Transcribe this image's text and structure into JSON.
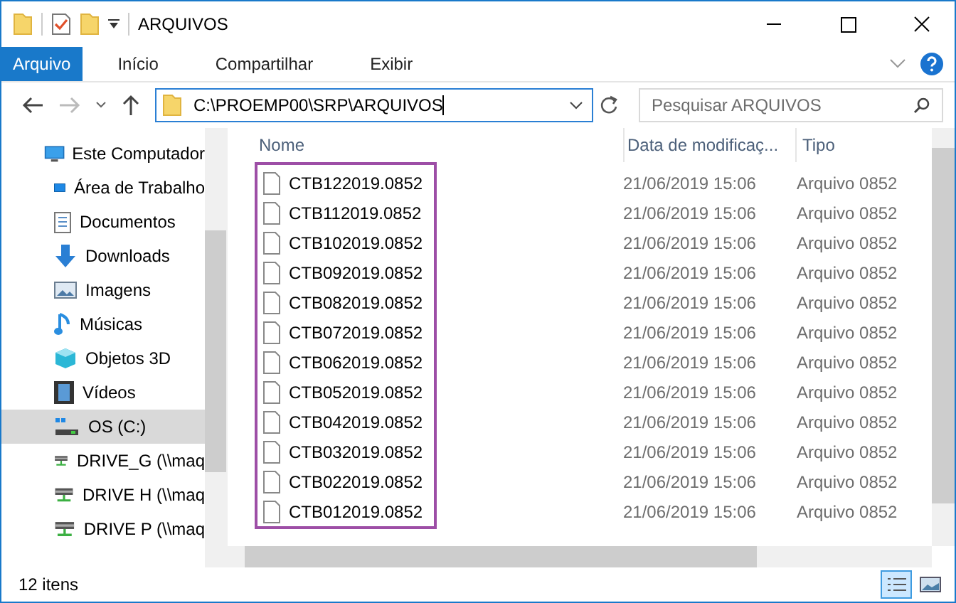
{
  "window": {
    "title": "ARQUIVOS"
  },
  "ribbon_tabs": [
    {
      "label": "Arquivo",
      "selected": true
    },
    {
      "label": "Início",
      "selected": false
    },
    {
      "label": "Compartilhar",
      "selected": false
    },
    {
      "label": "Exibir",
      "selected": false
    }
  ],
  "address": {
    "path": "C:\\PROEMP00\\SRP\\ARQUIVOS"
  },
  "search": {
    "placeholder": "Pesquisar ARQUIVOS"
  },
  "sidebar": {
    "items": [
      {
        "label": "Este Computador",
        "kind": "computer",
        "selected": false,
        "children": [
          {
            "label": "Área de Trabalho",
            "kind": "desktop",
            "selected": false
          },
          {
            "label": "Documentos",
            "kind": "documents",
            "selected": false
          },
          {
            "label": "Downloads",
            "kind": "downloads",
            "selected": false
          },
          {
            "label": "Imagens",
            "kind": "pictures",
            "selected": false
          },
          {
            "label": "Músicas",
            "kind": "music",
            "selected": false
          },
          {
            "label": "Objetos 3D",
            "kind": "objects3d",
            "selected": false
          },
          {
            "label": "Vídeos",
            "kind": "videos",
            "selected": false
          },
          {
            "label": "OS (C:)",
            "kind": "drive",
            "selected": true
          },
          {
            "label": "DRIVE_G (\\\\maq",
            "kind": "network",
            "selected": false
          },
          {
            "label": "DRIVE H (\\\\maq",
            "kind": "network",
            "selected": false
          },
          {
            "label": "DRIVE P (\\\\maq",
            "kind": "network",
            "selected": false
          }
        ]
      }
    ]
  },
  "table": {
    "columns": [
      "Nome",
      "Data de modificaç...",
      "Tipo"
    ],
    "rows": [
      {
        "name": "CTB122019.0852",
        "date": "21/06/2019 15:06",
        "type": "Arquivo 0852"
      },
      {
        "name": "CTB112019.0852",
        "date": "21/06/2019 15:06",
        "type": "Arquivo 0852"
      },
      {
        "name": "CTB102019.0852",
        "date": "21/06/2019 15:06",
        "type": "Arquivo 0852"
      },
      {
        "name": "CTB092019.0852",
        "date": "21/06/2019 15:06",
        "type": "Arquivo 0852"
      },
      {
        "name": "CTB082019.0852",
        "date": "21/06/2019 15:06",
        "type": "Arquivo 0852"
      },
      {
        "name": "CTB072019.0852",
        "date": "21/06/2019 15:06",
        "type": "Arquivo 0852"
      },
      {
        "name": "CTB062019.0852",
        "date": "21/06/2019 15:06",
        "type": "Arquivo 0852"
      },
      {
        "name": "CTB052019.0852",
        "date": "21/06/2019 15:06",
        "type": "Arquivo 0852"
      },
      {
        "name": "CTB042019.0852",
        "date": "21/06/2019 15:06",
        "type": "Arquivo 0852"
      },
      {
        "name": "CTB032019.0852",
        "date": "21/06/2019 15:06",
        "type": "Arquivo 0852"
      },
      {
        "name": "CTB022019.0852",
        "date": "21/06/2019 15:06",
        "type": "Arquivo 0852"
      },
      {
        "name": "CTB012019.0852",
        "date": "21/06/2019 15:06",
        "type": "Arquivo 0852"
      }
    ]
  },
  "status_bar": {
    "count": "12 itens"
  }
}
